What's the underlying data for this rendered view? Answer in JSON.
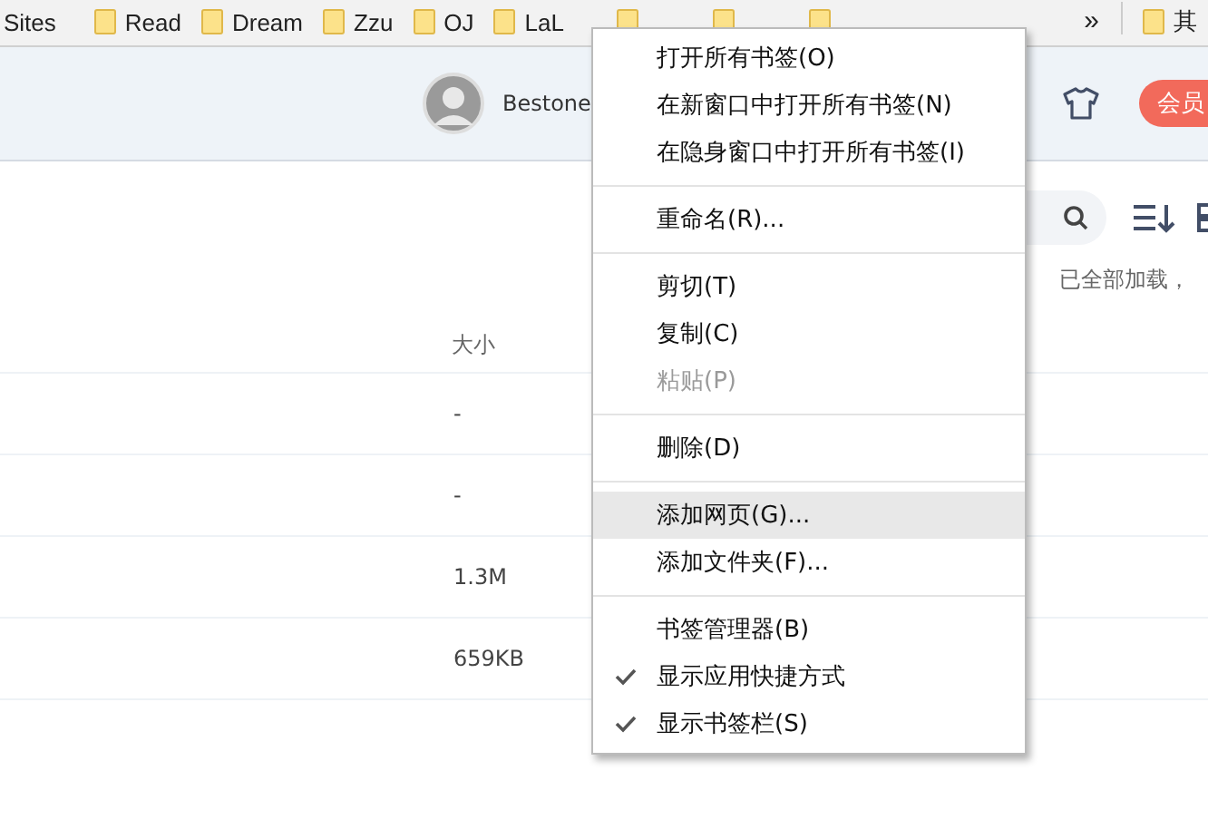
{
  "bookmarks_bar": {
    "items": [
      {
        "label": "Sites",
        "icon": false
      },
      {
        "label": "Read",
        "icon": true
      },
      {
        "label": "Dream",
        "icon": true
      },
      {
        "label": "Zzu",
        "icon": true
      },
      {
        "label": "OJ",
        "icon": true
      },
      {
        "label": "LaL",
        "icon": true
      },
      {
        "icon": true
      },
      {
        "icon": true
      },
      {
        "icon": true
      }
    ],
    "overflow": "»",
    "other": "其"
  },
  "header": {
    "user": "Bestone",
    "vip_button": "会员"
  },
  "toolbar": {
    "status": "已全部加载，"
  },
  "table": {
    "columns": [
      "大小"
    ],
    "rows": [
      {
        "size": "-"
      },
      {
        "size": "-"
      },
      {
        "size": "1.3M"
      },
      {
        "size": "659KB"
      }
    ]
  },
  "context_menu": {
    "groups": [
      [
        {
          "label": "打开所有书签(O)",
          "disabled": false,
          "checked": false,
          "selected": false
        },
        {
          "label": "在新窗口中打开所有书签(N)",
          "disabled": false,
          "checked": false,
          "selected": false
        },
        {
          "label": "在隐身窗口中打开所有书签(I)",
          "disabled": false,
          "checked": false,
          "selected": false
        }
      ],
      [
        {
          "label": "重命名(R)...",
          "disabled": false,
          "checked": false,
          "selected": false
        }
      ],
      [
        {
          "label": "剪切(T)",
          "disabled": false,
          "checked": false,
          "selected": false
        },
        {
          "label": "复制(C)",
          "disabled": false,
          "checked": false,
          "selected": false
        },
        {
          "label": "粘贴(P)",
          "disabled": true,
          "checked": false,
          "selected": false
        }
      ],
      [
        {
          "label": "删除(D)",
          "disabled": false,
          "checked": false,
          "selected": false
        }
      ],
      [
        {
          "label": "添加网页(G)...",
          "disabled": false,
          "checked": false,
          "selected": true
        },
        {
          "label": "添加文件夹(F)...",
          "disabled": false,
          "checked": false,
          "selected": false
        }
      ],
      [
        {
          "label": "书签管理器(B)",
          "disabled": false,
          "checked": false,
          "selected": false
        },
        {
          "label": "显示应用快捷方式",
          "disabled": false,
          "checked": true,
          "selected": false
        },
        {
          "label": "显示书签栏(S)",
          "disabled": false,
          "checked": true,
          "selected": false
        }
      ]
    ]
  }
}
